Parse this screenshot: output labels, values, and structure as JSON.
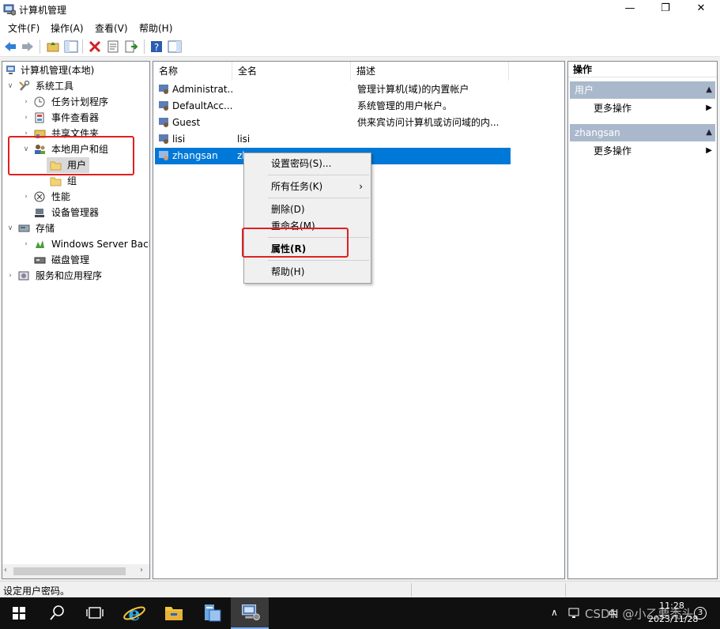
{
  "window": {
    "title": "计算机管理",
    "minimize": "—",
    "restore": "❐",
    "close": "✕"
  },
  "menu": [
    "文件(F)",
    "操作(A)",
    "查看(V)",
    "帮助(H)"
  ],
  "tree": {
    "root": "计算机管理(本地)",
    "system_tools": "系统工具",
    "task_scheduler": "任务计划程序",
    "event_viewer": "事件查看器",
    "shared_folders": "共享文件夹",
    "local_users_groups": "本地用户和组",
    "users": "用户",
    "groups": "组",
    "performance": "性能",
    "device_manager": "设备管理器",
    "storage": "存储",
    "windows_server_backup": "Windows Server Back",
    "disk_management": "磁盘管理",
    "services_apps": "服务和应用程序"
  },
  "list": {
    "columns": [
      "名称",
      "全名",
      "描述"
    ],
    "rows": [
      {
        "name": "Administrat...",
        "fullname": "",
        "description": "管理计算机(域)的内置帐户"
      },
      {
        "name": "DefaultAcc...",
        "fullname": "",
        "description": "系统管理的用户帐户。"
      },
      {
        "name": "Guest",
        "fullname": "",
        "description": "供来宾访问计算机或访问域的内..."
      },
      {
        "name": "lisi",
        "fullname": "lisi",
        "description": ""
      },
      {
        "name": "zhangsan",
        "fullname": "zh",
        "description": ""
      }
    ]
  },
  "context_menu": {
    "set_password": "设置密码(S)...",
    "all_tasks": "所有任务(K)",
    "delete": "删除(D)",
    "rename": "重命名(M)",
    "properties": "属性(R)",
    "help": "帮助(H)"
  },
  "actions": {
    "title": "操作",
    "section1": "用户",
    "section1_more": "更多操作",
    "section2": "zhangsan",
    "section2_more": "更多操作"
  },
  "status": "设定用户密码。",
  "taskbar": {
    "ime": "中",
    "time": "11:28",
    "date": "2023/11/28",
    "watermark": "CSDN @小乙要秃头",
    "notification_count": "3"
  },
  "colors": {
    "selection": "#0078d7",
    "highlight_box": "#e02020",
    "action_section": "#aab8cc"
  }
}
